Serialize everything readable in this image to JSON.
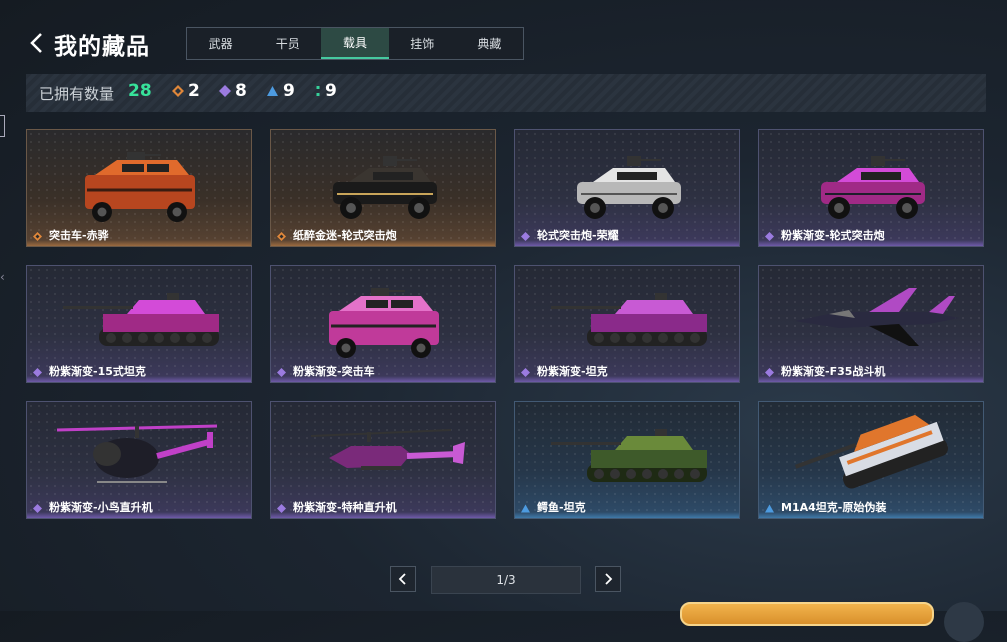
{
  "header": {
    "title": "我的藏品"
  },
  "tabs": [
    {
      "label": "武器",
      "active": false
    },
    {
      "label": "干员",
      "active": false
    },
    {
      "label": "载具",
      "active": true
    },
    {
      "label": "挂饰",
      "active": false
    },
    {
      "label": "典藏",
      "active": false
    }
  ],
  "stats": {
    "owned_label": "已拥有数量",
    "owned_count": "28",
    "rarity_counts": [
      {
        "icon": "orange-diamond-icon",
        "color": "#e0873a",
        "count": "2"
      },
      {
        "icon": "purple-diamond-icon",
        "color": "#9b7be0",
        "count": "8"
      },
      {
        "icon": "blue-triangle-icon",
        "color": "#4d9be0",
        "count": "9"
      },
      {
        "icon": "green-dots-icon",
        "color": "#36d19a",
        "count": "9"
      }
    ]
  },
  "items": [
    {
      "name": "突击车-赤骅",
      "rarity": "gold",
      "vehicle": "armored-car",
      "palette": [
        "#b8461f",
        "#e06a2c",
        "#3a1c10"
      ]
    },
    {
      "name": "纸醉金迷-轮式突击炮",
      "rarity": "gold",
      "vehicle": "buggy",
      "palette": [
        "#1a1a1a",
        "#3a3530",
        "#c9a55a"
      ]
    },
    {
      "name": "轮式突击炮-荣耀",
      "rarity": "purple",
      "vehicle": "buggy",
      "palette": [
        "#b8b8b8",
        "#e4e4e4",
        "#555"
      ]
    },
    {
      "name": "粉紫渐变-轮式突击炮",
      "rarity": "purple",
      "vehicle": "buggy",
      "palette": [
        "#a02a86",
        "#d34bd8",
        "#1e1e2a"
      ]
    },
    {
      "name": "粉紫渐变-15式坦克",
      "rarity": "purple",
      "vehicle": "tank",
      "palette": [
        "#a02a86",
        "#d34bd8",
        "#222"
      ]
    },
    {
      "name": "粉紫渐变-突击车",
      "rarity": "purple",
      "vehicle": "armored-car",
      "palette": [
        "#c03a9a",
        "#e472c9",
        "#222"
      ]
    },
    {
      "name": "粉紫渐变-坦克",
      "rarity": "purple",
      "vehicle": "tank",
      "palette": [
        "#8a2a8a",
        "#c85ad4",
        "#222"
      ]
    },
    {
      "name": "粉紫渐变-F35战斗机",
      "rarity": "purple",
      "vehicle": "jet",
      "palette": [
        "#2a2a40",
        "#b04ac4",
        "#111"
      ]
    },
    {
      "name": "粉紫渐变-小鸟直升机",
      "rarity": "purple",
      "vehicle": "heli-small",
      "palette": [
        "#1e1e28",
        "#c040c8",
        "#888"
      ]
    },
    {
      "name": "粉紫渐变-特种直升机",
      "rarity": "purple",
      "vehicle": "heli-attack",
      "palette": [
        "#7a2a7a",
        "#c85ad4",
        "#333"
      ]
    },
    {
      "name": "鳄鱼-坦克",
      "rarity": "blue",
      "vehicle": "tank",
      "palette": [
        "#3e5a2a",
        "#6a8a3a",
        "#1e2a14"
      ]
    },
    {
      "name": "M1A4坦克-原始伪装",
      "rarity": "blue",
      "vehicle": "tank-angled",
      "palette": [
        "#d8dce4",
        "#e0762c",
        "#222"
      ]
    }
  ],
  "pagination": {
    "page_text": "1/3",
    "prev_icon": "chevron-left-icon",
    "next_icon": "chevron-right-icon"
  },
  "colors": {
    "accent": "#37e29a",
    "gold": "#e0873a",
    "purple": "#9b7be0",
    "blue": "#4d9be0"
  }
}
